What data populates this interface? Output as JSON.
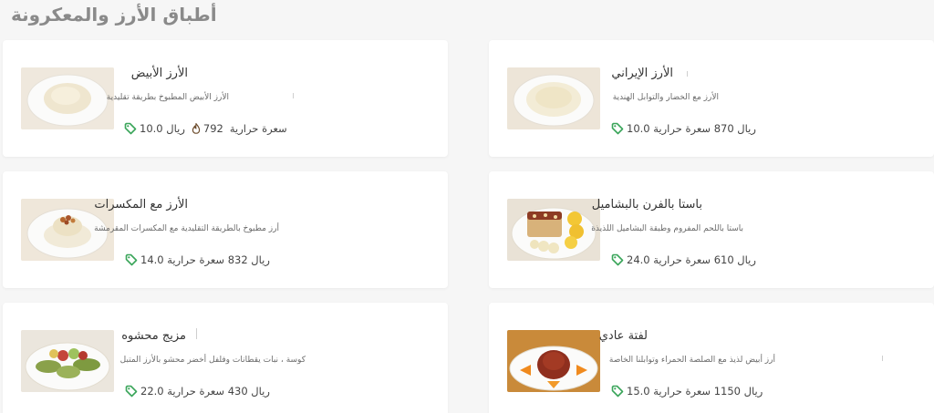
{
  "section": {
    "title": "أطباق الأرز والمعكرونة"
  },
  "colors": {
    "accent": "#3aa55a",
    "text": "#333333",
    "muted": "#6b6b6b",
    "flame": "#6b4a2a"
  },
  "dishes": [
    {
      "name": "الأرز الأبيض",
      "description": "الأرز الأبيض المطبوخ بطريقة تقليدية",
      "calories_label": "سعرة حرارية",
      "calories": "792",
      "price": "ريال 10.0",
      "icon": "flame-icon"
    },
    {
      "name": "الأرز الإيراني",
      "description": "الأرز مع الخضار والتوابل الهندية",
      "meta": "ريال 870 سعرة حرارية 10.0"
    },
    {
      "name": "الأرز مع المكسرات",
      "description": "أرز مطبوخ بالطريقة التقليدية مع المكسرات المقرمشة",
      "meta": "ريال 832 سعرة حرارية 14.0"
    },
    {
      "name": "باستا بالفرن بالبشاميل",
      "description": "باستا باللحم المفروم وطبقة البشاميل اللذيذة",
      "meta": "ريال 610 سعرة حرارية 24.0"
    },
    {
      "name": "مزيج محشوه",
      "description": "كوسة ، نبات يقطانات وفلفل أخضر محشو بالأرز المتبل",
      "meta": "ريال 430 سعرة حرارية 22.0"
    },
    {
      "name": "لفتة عادي",
      "description": "أرز أبيض لذيذ مع الصلصة الحمراء وتوابلنا الخاصة",
      "meta": "ريال 1150 سعرة حرارية 15.0"
    }
  ]
}
